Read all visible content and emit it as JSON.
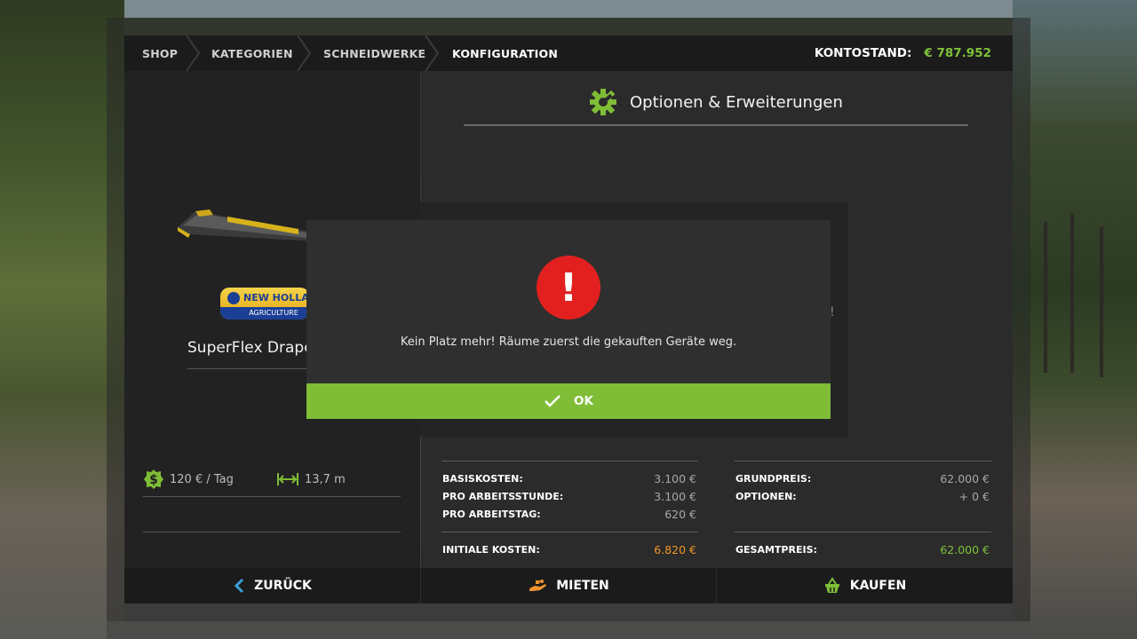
{
  "breadcrumb": {
    "items": [
      "SHOP",
      "KATEGORIEN",
      "SCHNEIDWERKE",
      "KONFIGURATION"
    ]
  },
  "account": {
    "label": "KONTOSTAND:",
    "amount": "€ 787.952"
  },
  "section": {
    "title": "Optionen & Erweiterungen"
  },
  "product": {
    "name": "SuperFlex Draper",
    "brand_top": "NEW HOLLAND",
    "brand_bottom": "AGRICULTURE",
    "rent_per_day": "120 € / Tag",
    "width": "13,7 m"
  },
  "costs": {
    "left": [
      {
        "label": "BASISKOSTEN:",
        "value": "3.100 €"
      },
      {
        "label": "PRO ARBEITSSTUNDE:",
        "value": "3.100 €"
      },
      {
        "label": "PRO ARBEITSTAG:",
        "value": "620 €"
      }
    ],
    "left_total": {
      "label": "INITIALE KOSTEN:",
      "value": "6.820 €"
    },
    "right": [
      {
        "label": "GRUNDPREIS:",
        "value": "62.000 €"
      },
      {
        "label": "OPTIONEN:",
        "value": "+ 0 €"
      }
    ],
    "right_total": {
      "label": "GESAMTPREIS:",
      "value": "62.000 €"
    }
  },
  "buttons": {
    "back": "ZURÜCK",
    "rent": "MIETEN",
    "buy": "KAUFEN"
  },
  "dialog": {
    "message": "Kein Platz mehr! Räume zuerst die gekauften Geräte weg.",
    "ok": "OK",
    "alert_symbol": "!"
  },
  "colors": {
    "accent_green": "#7fbd37",
    "money_green": "#7fc23b",
    "initial_cost_orange": "#f0932b",
    "alert_red": "#e32020",
    "back_arrow_blue": "#3a9fd8"
  },
  "icons": [
    "options-gear-icon",
    "money-icon",
    "width-icon",
    "back-arrow-icon",
    "rent-hand-icon",
    "buy-basket-icon",
    "checkmark-icon",
    "alert-icon"
  ]
}
